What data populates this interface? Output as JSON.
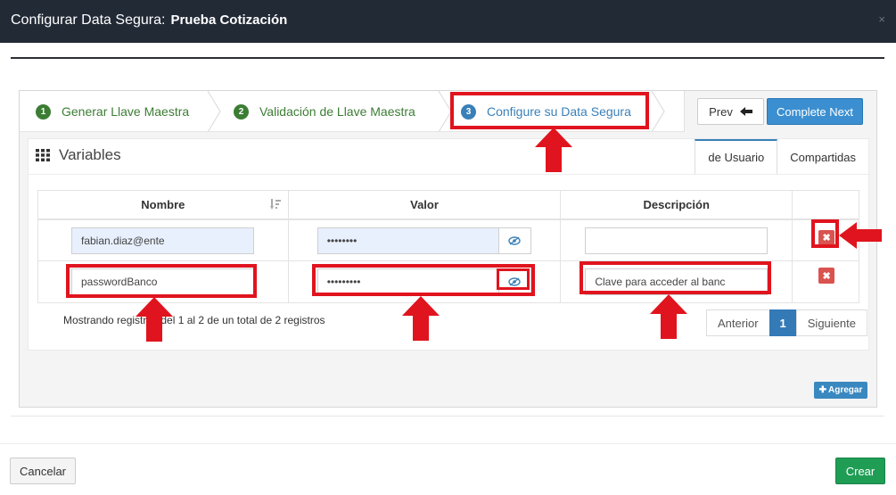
{
  "header": {
    "title": "Configurar Data Segura:",
    "subtitle": "Prueba Cotización",
    "close_symbol": "×"
  },
  "wizard": {
    "steps": [
      {
        "number": "1",
        "label": "Generar Llave Maestra"
      },
      {
        "number": "2",
        "label": "Validación de Llave Maestra"
      },
      {
        "number": "3",
        "label": "Configure su Data Segura"
      }
    ],
    "prev_label": "Prev",
    "next_label": "Complete Next"
  },
  "panel": {
    "title": "Variables",
    "tabs": [
      "de Usuario",
      "Compartidas"
    ]
  },
  "table": {
    "columns": [
      "Nombre",
      "Valor",
      "Descripción"
    ],
    "rows": [
      {
        "nombre": "fabian.diaz@ente",
        "valor": "••••••••",
        "descripcion": ""
      },
      {
        "nombre": "passwordBanco",
        "valor": "•••••••••",
        "descripcion": "Clave para acceder al banc"
      }
    ]
  },
  "info_text": "Mostrando registros del 1 al 2 de un total de 2 registros",
  "pagination": {
    "prev": "Anterior",
    "current": "1",
    "next": "Siguiente"
  },
  "add_label": "Agregar",
  "footer": {
    "cancel_label": "Cancelar",
    "create_label": "Crear"
  },
  "colors": {
    "header_bg": "#222a36",
    "step_done": "#3c7d34",
    "step_active": "#3a80b8",
    "primary": "#3b8fd0",
    "danger": "#d9534f",
    "success": "#1f9d55",
    "annotation": "#e0141e"
  }
}
